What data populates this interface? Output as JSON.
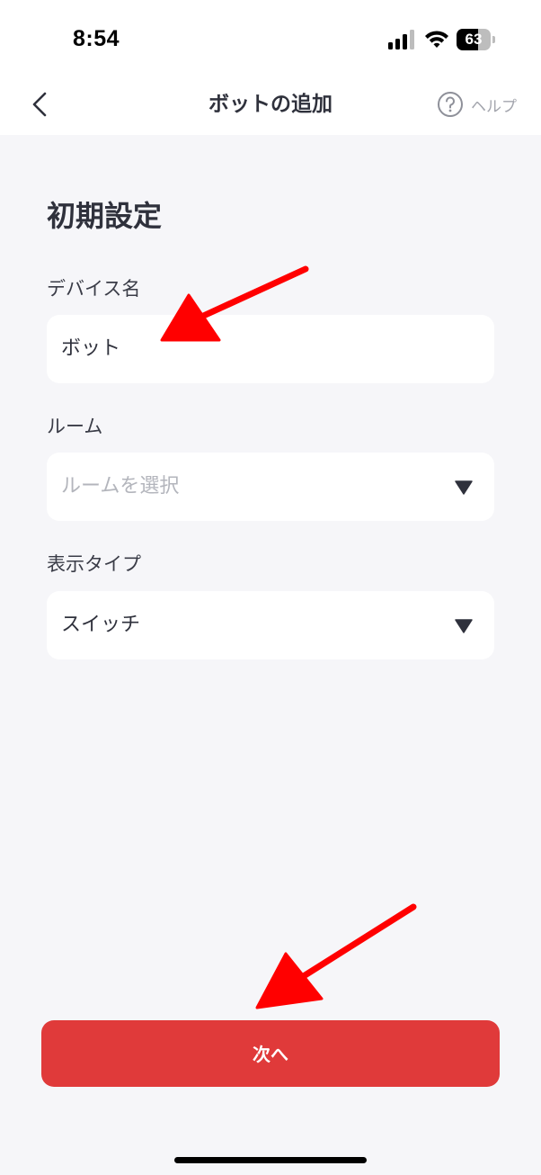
{
  "status_bar": {
    "time": "8:54",
    "battery_level": "63",
    "battery_fraction": 0.63,
    "icons": [
      "signal-icon",
      "wifi-icon",
      "battery-icon"
    ]
  },
  "nav": {
    "title": "ボットの追加",
    "help_label": "ヘルプ",
    "back_icon": "chevron-left-icon",
    "help_icon": "question-circle-icon"
  },
  "form": {
    "section_title": "初期設定",
    "device_name": {
      "label": "デバイス名",
      "value": "ボット"
    },
    "room": {
      "label": "ルーム",
      "placeholder": "ルームを選択"
    },
    "display_type": {
      "label": "表示タイプ",
      "value": "スイッチ"
    }
  },
  "footer": {
    "next_label": "次へ"
  },
  "colors": {
    "accent": "#e03a3a",
    "annotation_arrow": "#ff0000",
    "background": "#f6f6f9",
    "text": "#2f313c",
    "placeholder": "#b3b5bc"
  }
}
